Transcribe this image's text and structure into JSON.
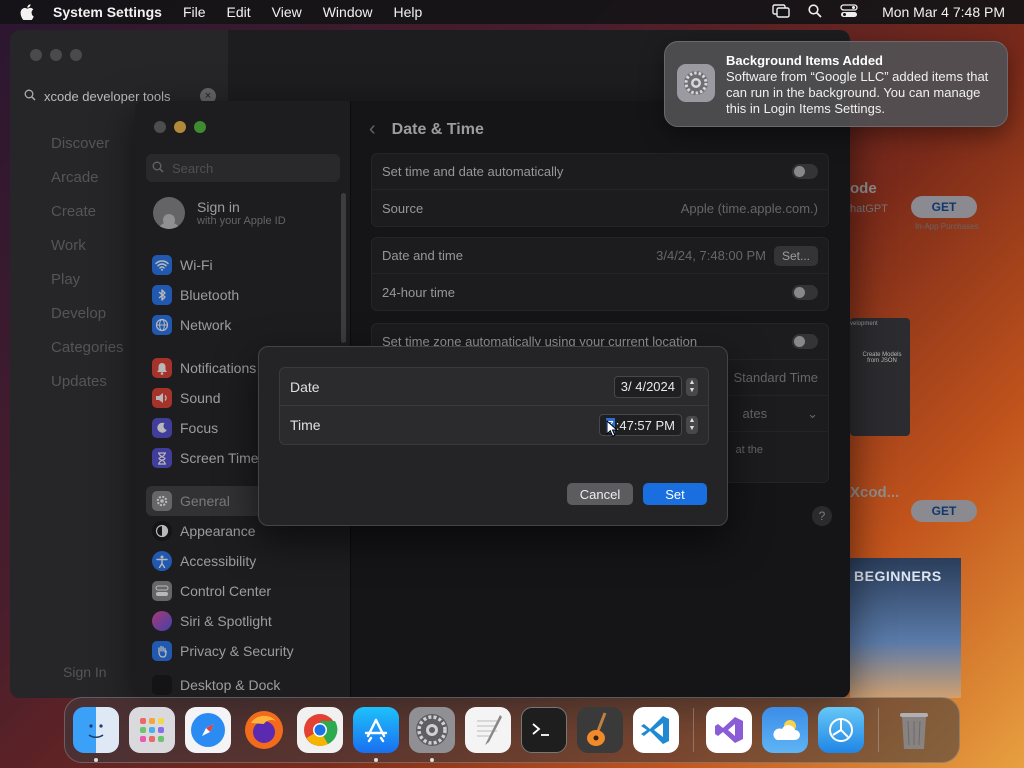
{
  "menubar": {
    "app_name": "System Settings",
    "menus": [
      "File",
      "Edit",
      "View",
      "Window",
      "Help"
    ],
    "clock": "Mon Mar 4  7:48 PM"
  },
  "appstore": {
    "search_value": "xcode developer tools",
    "nav": [
      "Discover",
      "Arcade",
      "Create",
      "Work",
      "Play",
      "Develop",
      "Categories",
      "Updates"
    ],
    "sign_in": "Sign In",
    "get_label": "GET",
    "in_app": "In-App Purchases",
    "app1_name": "ode",
    "app1_sub": "hatGPT",
    "app2_name": "Xcod...",
    "promo_text": "Create Models from JSON",
    "promo_small": "velopment",
    "beginners": "BEGINNERS"
  },
  "settings": {
    "search_placeholder": "Search",
    "sign_in": "Sign in",
    "sign_in_sub": "with your Apple ID",
    "sidebar_group1": [
      {
        "label": "Wi-Fi",
        "icon": "wifi-icon",
        "color": "#2f7cf6"
      },
      {
        "label": "Bluetooth",
        "icon": "bluetooth-icon",
        "color": "#2f7cf6"
      },
      {
        "label": "Network",
        "icon": "globe-icon",
        "color": "#2f7cf6"
      }
    ],
    "sidebar_group2": [
      {
        "label": "Notifications",
        "icon": "bell-icon",
        "color": "#e5473d"
      },
      {
        "label": "Sound",
        "icon": "speaker-icon",
        "color": "#e5473d"
      },
      {
        "label": "Focus",
        "icon": "moon-icon",
        "color": "#5b55d6"
      },
      {
        "label": "Screen Time",
        "icon": "hourglass-icon",
        "color": "#5b55d6"
      }
    ],
    "sidebar_group3": [
      {
        "label": "General",
        "icon": "gear-icon",
        "color": "#8e8e93",
        "active": true
      },
      {
        "label": "Appearance",
        "icon": "appearance-icon",
        "color": "#1c1c1e"
      },
      {
        "label": "Accessibility",
        "icon": "accessibility-icon",
        "color": "#2f7cf6"
      },
      {
        "label": "Control Center",
        "icon": "control-center-icon",
        "color": "#8e8e93"
      },
      {
        "label": "Siri & Spotlight",
        "icon": "siri-icon",
        "color": "#b44bd6"
      },
      {
        "label": "Privacy & Security",
        "icon": "hand-icon",
        "color": "#2f7cf6"
      },
      {
        "label": "Desktop & Dock",
        "icon": "dock-icon",
        "color": "#1c1c1e"
      }
    ],
    "page_title": "Date & Time",
    "auto_time_label": "Set time and date automatically",
    "source_label": "Source",
    "source_value": "Apple (time.apple.com.)",
    "date_time_label": "Date and time",
    "date_time_value": "3/4/24, 7:48:00 PM",
    "set_button": "Set...",
    "hour24_label": "24-hour time",
    "tz_auto_label": "Set time zone automatically using your current location",
    "tz_value": "Standard Time",
    "tz_partial": "ates",
    "tz_note": "at the"
  },
  "dialog": {
    "date_label": "Date",
    "date_value": "3/  4/2024",
    "time_label": "Time",
    "time_selected": "7",
    "time_rest": ":47:57 PM",
    "cancel": "Cancel",
    "set": "Set"
  },
  "notification": {
    "title": "Background Items Added",
    "body": "Software from “Google LLC” added items that can run in the background. You can manage this in Login Items Settings."
  },
  "dock": [
    {
      "name": "finder-icon",
      "color": "#2d8ff0",
      "running": true
    },
    {
      "name": "launchpad-icon",
      "color": "#d9d9de",
      "running": false
    },
    {
      "name": "safari-icon",
      "color": "#2a8cf2",
      "running": false
    },
    {
      "name": "firefox-icon",
      "color": "#f26b1d",
      "running": false
    },
    {
      "name": "chrome-icon",
      "color": "#f1f1f1",
      "running": false
    },
    {
      "name": "app-store-icon",
      "color": "#1a8ef5",
      "running": true
    },
    {
      "name": "system-settings-icon",
      "color": "#8f8f94",
      "running": true
    },
    {
      "name": "textedit-icon",
      "color": "#f4f4f4",
      "running": false
    },
    {
      "name": "terminal-icon",
      "color": "#1e1e1e",
      "running": false
    },
    {
      "name": "garageband-icon",
      "color": "#3a3a3a",
      "running": false
    },
    {
      "name": "vscode-icon",
      "color": "#ffffff",
      "running": false
    },
    {
      "name": "visual-studio-icon",
      "color": "#ffffff",
      "running": false
    },
    {
      "name": "weather-icon",
      "color": "#3b8de8",
      "running": false
    },
    {
      "name": "instruments-icon",
      "color": "#2e9cf0",
      "running": false
    },
    {
      "name": "trash-icon",
      "color": "#8a8a8e",
      "running": false
    }
  ]
}
